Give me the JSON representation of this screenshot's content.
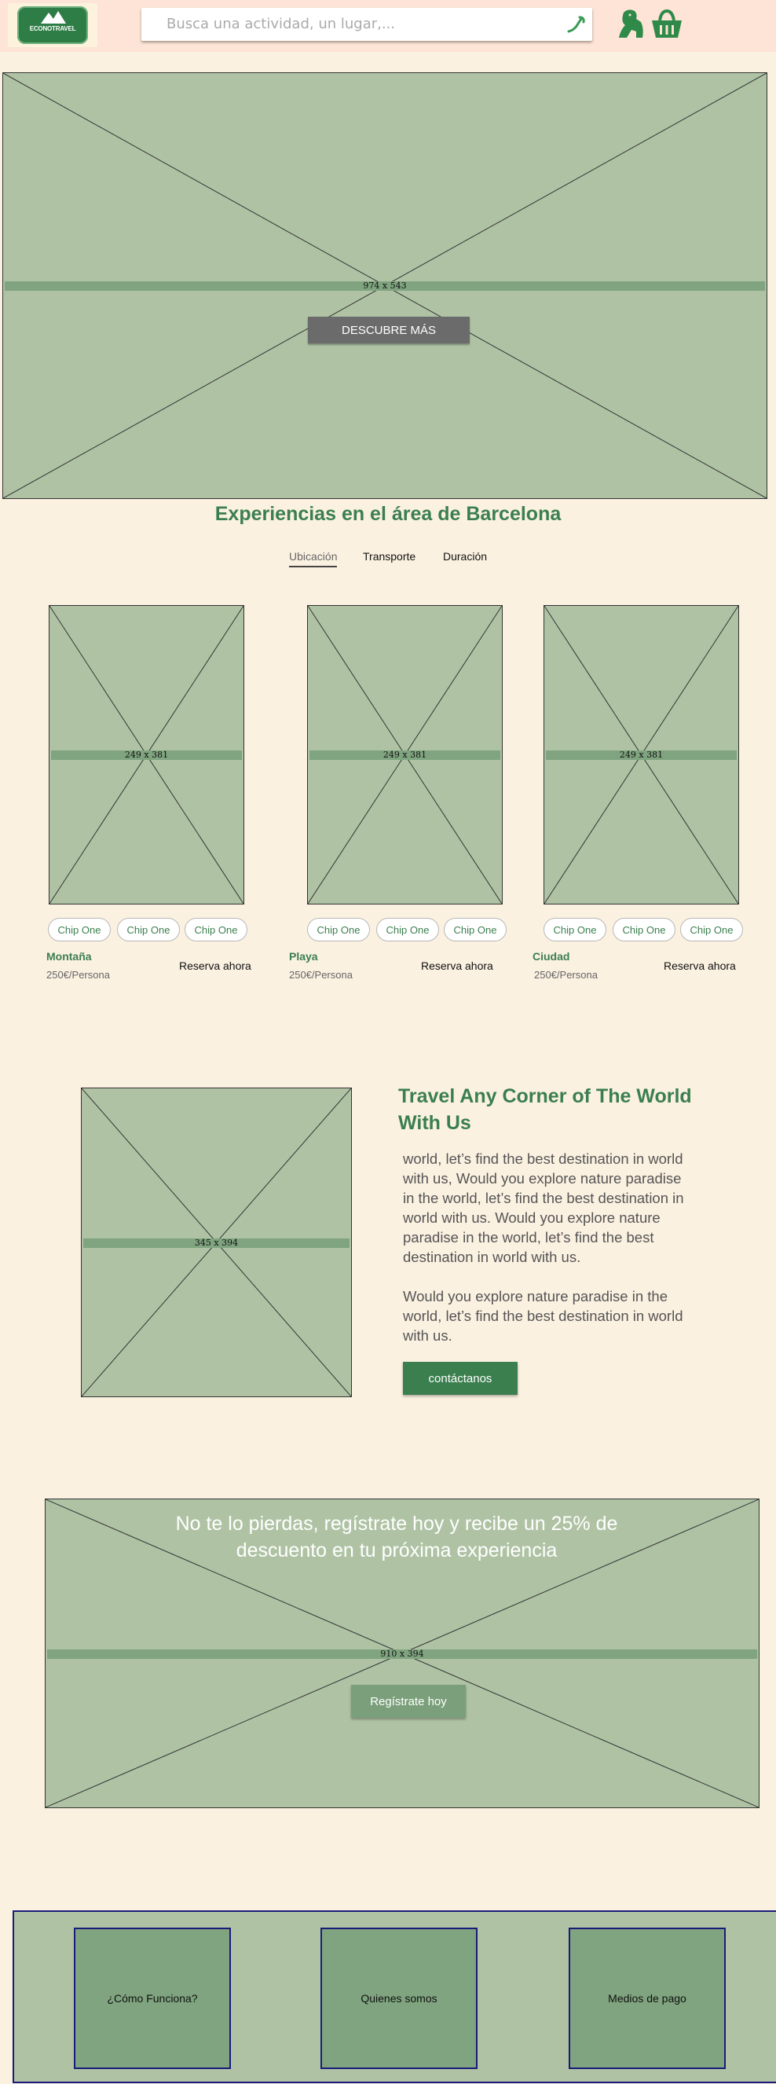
{
  "header": {
    "logo_text": "ECONOTRAVEL",
    "search_placeholder": "Busca una actividad, un lugar,...",
    "icons": [
      "search-icon",
      "gorilla-icon",
      "basket-icon"
    ]
  },
  "hero": {
    "placeholder_label": "974 x 543",
    "button_label": "DESCUBRE MÁS"
  },
  "experiences": {
    "title": "Experiencias en el área de Barcelona",
    "tabs": [
      {
        "label": "Ubicación",
        "active": true
      },
      {
        "label": "Transporte",
        "active": false
      },
      {
        "label": "Duración",
        "active": false
      }
    ],
    "cards": [
      {
        "placeholder_label": "249 x 381",
        "chips": [
          "Chip One",
          "Chip One",
          "Chip One"
        ],
        "name": "Montaña",
        "price": "250€/Persona",
        "book_label": "Reserva ahora"
      },
      {
        "placeholder_label": "249 x 381",
        "chips": [
          "Chip One",
          "Chip One",
          "Chip One"
        ],
        "name": "Playa",
        "price": "250€/Persona",
        "book_label": "Reserva ahora"
      },
      {
        "placeholder_label": "249 x 381",
        "chips": [
          "Chip One",
          "Chip One",
          "Chip One"
        ],
        "name": "Ciudad",
        "price": "250€/Persona",
        "book_label": "Reserva ahora"
      }
    ]
  },
  "travel": {
    "placeholder_label": "345 x 394",
    "title": "Travel Any Corner of The World With Us",
    "paragraph1": "world, let’s find the best destination in world with us, Would you explore nature paradise in the world, let’s find the best destination in world with us. Would you explore nature paradise in the world, let’s find the best destination in world with us.",
    "paragraph2": "Would you explore nature paradise in the world, let’s find the best destination in world with us.",
    "button_label": "contáctanos"
  },
  "promo": {
    "placeholder_label": "910 x 394",
    "text": "No te lo pierdas, regístrate hoy y recibe un 25% de descuento en tu próxima experiencia",
    "button_label": "Regístrate hoy"
  },
  "footer": {
    "items": [
      "¿Cómo Funciona?",
      "Quienes somos",
      "Medios de pago"
    ]
  },
  "colors": {
    "background": "#fbf1e1",
    "header": "#fde4d6",
    "brand_green": "#3b7f4f",
    "placeholder": "#afc3a4",
    "footer_border": "#1a1a7a"
  }
}
